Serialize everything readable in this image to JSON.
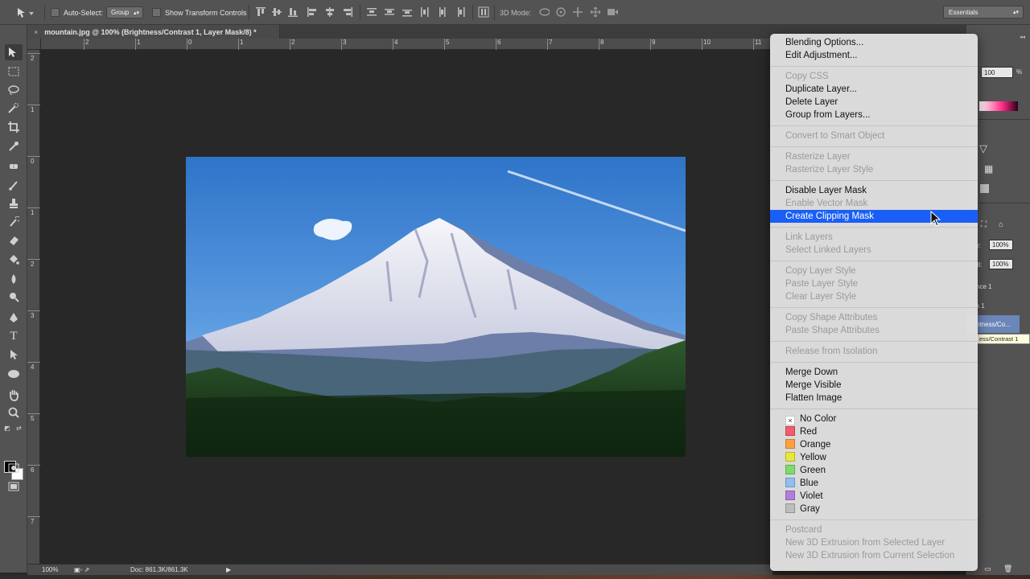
{
  "options_bar": {
    "auto_select_label": "Auto-Select:",
    "auto_select_value": "Group",
    "show_transform_label": "Show Transform Controls",
    "mode_3d_label": "3D Mode:",
    "workspace": "Essentials"
  },
  "document": {
    "tab_title": "mountain.jpg @ 100% (Brightness/Contrast 1, Layer Mask/8) *",
    "close_glyph": "×"
  },
  "rulers": {
    "top_ticks": [
      "2",
      "1",
      "0",
      "1",
      "2",
      "3",
      "4",
      "5",
      "6",
      "7",
      "8",
      "9",
      "10",
      "11"
    ],
    "left_ticks": [
      "2",
      "1",
      "0",
      "1",
      "2",
      "3",
      "4",
      "5",
      "6",
      "7"
    ]
  },
  "status_bar": {
    "zoom": "100%",
    "doc_info": "Doc: 861.3K/861.3K",
    "arrow": "▶"
  },
  "right_panel": {
    "opacity_value": "100",
    "opacity_unit": "%",
    "layers_opacity_label": "y:",
    "layers_opacity": "100%",
    "layers_fill_label": "ill:",
    "layers_fill": "100%",
    "layer_1": "nce 1",
    "layer_2": "s 1",
    "layer_3": "htness/Co...",
    "tooltip": "ess/Contrast 1"
  },
  "context_menu": {
    "groups": [
      [
        {
          "label": "Blending Options...",
          "enabled": true
        },
        {
          "label": "Edit Adjustment...",
          "enabled": true
        }
      ],
      [
        {
          "label": "Copy CSS",
          "enabled": false
        },
        {
          "label": "Duplicate Layer...",
          "enabled": true
        },
        {
          "label": "Delete Layer",
          "enabled": true
        },
        {
          "label": "Group from Layers...",
          "enabled": true
        }
      ],
      [
        {
          "label": "Convert to Smart Object",
          "enabled": false
        }
      ],
      [
        {
          "label": "Rasterize Layer",
          "enabled": false
        },
        {
          "label": "Rasterize Layer Style",
          "enabled": false
        }
      ],
      [
        {
          "label": "Disable Layer Mask",
          "enabled": true
        },
        {
          "label": "Enable Vector Mask",
          "enabled": false
        },
        {
          "label": "Create Clipping Mask",
          "enabled": true,
          "selected": true
        }
      ],
      [
        {
          "label": "Link Layers",
          "enabled": false
        },
        {
          "label": "Select Linked Layers",
          "enabled": false
        }
      ],
      [
        {
          "label": "Copy Layer Style",
          "enabled": false
        },
        {
          "label": "Paste Layer Style",
          "enabled": false
        },
        {
          "label": "Clear Layer Style",
          "enabled": false
        }
      ],
      [
        {
          "label": "Copy Shape Attributes",
          "enabled": false
        },
        {
          "label": "Paste Shape Attributes",
          "enabled": false
        }
      ],
      [
        {
          "label": "Release from Isolation",
          "enabled": false
        }
      ],
      [
        {
          "label": "Merge Down",
          "enabled": true
        },
        {
          "label": "Merge Visible",
          "enabled": true
        },
        {
          "label": "Flatten Image",
          "enabled": true
        }
      ],
      [
        {
          "label": "No Color",
          "enabled": true,
          "color": "#ffffff",
          "mark": "×"
        },
        {
          "label": "Red",
          "enabled": true,
          "color": "#f25c6e"
        },
        {
          "label": "Orange",
          "enabled": true,
          "color": "#ffa040"
        },
        {
          "label": "Yellow",
          "enabled": true,
          "color": "#e8e83c"
        },
        {
          "label": "Green",
          "enabled": true,
          "color": "#7ddc6a"
        },
        {
          "label": "Blue",
          "enabled": true,
          "color": "#8fc0f5"
        },
        {
          "label": "Violet",
          "enabled": true,
          "color": "#b27ddc"
        },
        {
          "label": "Gray",
          "enabled": true,
          "color": "#bdbdbd"
        }
      ],
      [
        {
          "label": "Postcard",
          "enabled": false
        },
        {
          "label": "New 3D Extrusion from Selected Layer",
          "enabled": false
        },
        {
          "label": "New 3D Extrusion from Current Selection",
          "enabled": false
        }
      ]
    ]
  },
  "tools": [
    "move-tool",
    "marquee-tool",
    "lasso-tool",
    "quick-selection-tool",
    "crop-tool",
    "eyedropper-tool",
    "healing-brush-tool",
    "brush-tool",
    "clone-stamp-tool",
    "history-brush-tool",
    "eraser-tool",
    "paint-bucket-tool",
    "blur-tool",
    "dodge-tool",
    "pen-tool",
    "type-tool",
    "path-selection-tool",
    "ellipse-tool",
    "hand-tool",
    "zoom-tool"
  ]
}
